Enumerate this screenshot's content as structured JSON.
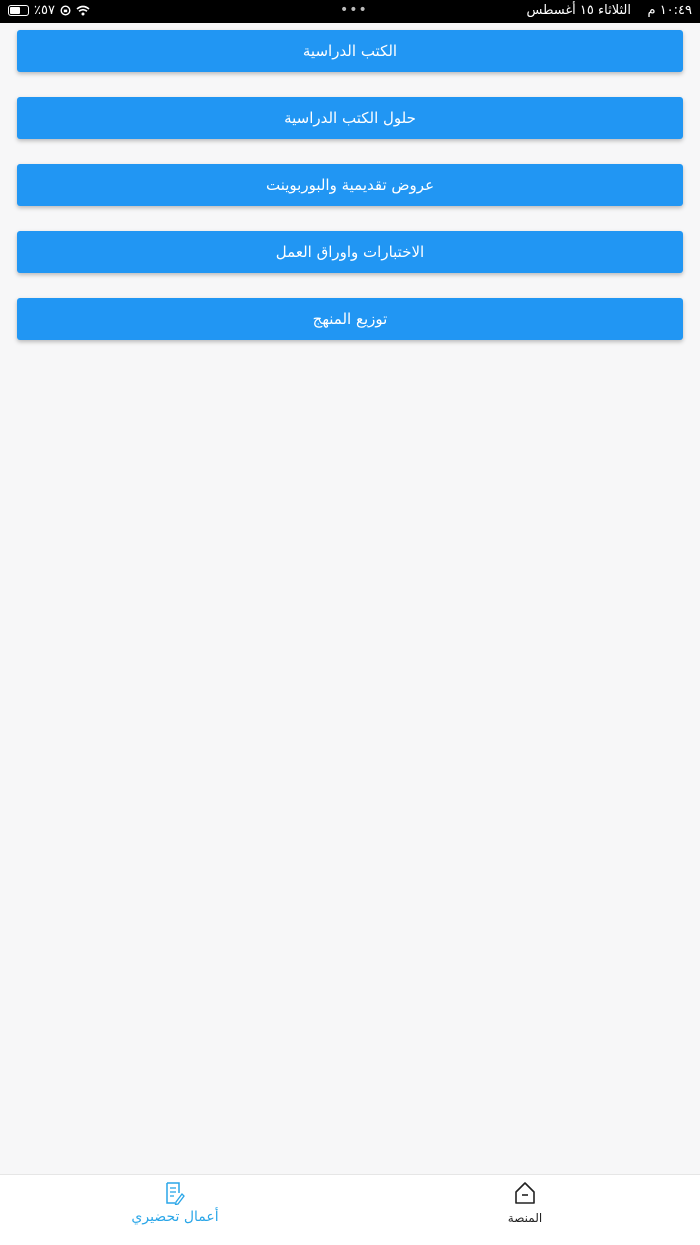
{
  "status_bar": {
    "battery_percent": "٪٥٧",
    "battery_level": 0.57,
    "time": "١٠:٤٩ م",
    "date": "الثلاثاء ١٥ أغسطس",
    "icons": [
      "battery-icon",
      "lock-rotation-icon",
      "wifi-icon"
    ]
  },
  "menu": {
    "items": [
      {
        "label": "الكتب الدراسية"
      },
      {
        "label": "حلول الكتب الدراسية"
      },
      {
        "label": "عروض تقديمية والبوربوينت"
      },
      {
        "label": "الاختبارات واوراق العمل"
      },
      {
        "label": "توزيع المنهج"
      }
    ]
  },
  "bottom_nav": {
    "items": [
      {
        "label": "أعمال تحضيري",
        "icon": "document-edit-icon",
        "active": true
      },
      {
        "label": "المنصة",
        "icon": "home-icon",
        "active": false
      }
    ]
  },
  "colors": {
    "primary": "#2196f3",
    "active_tab": "#2aa6e8",
    "background": "#f7f7f8"
  }
}
